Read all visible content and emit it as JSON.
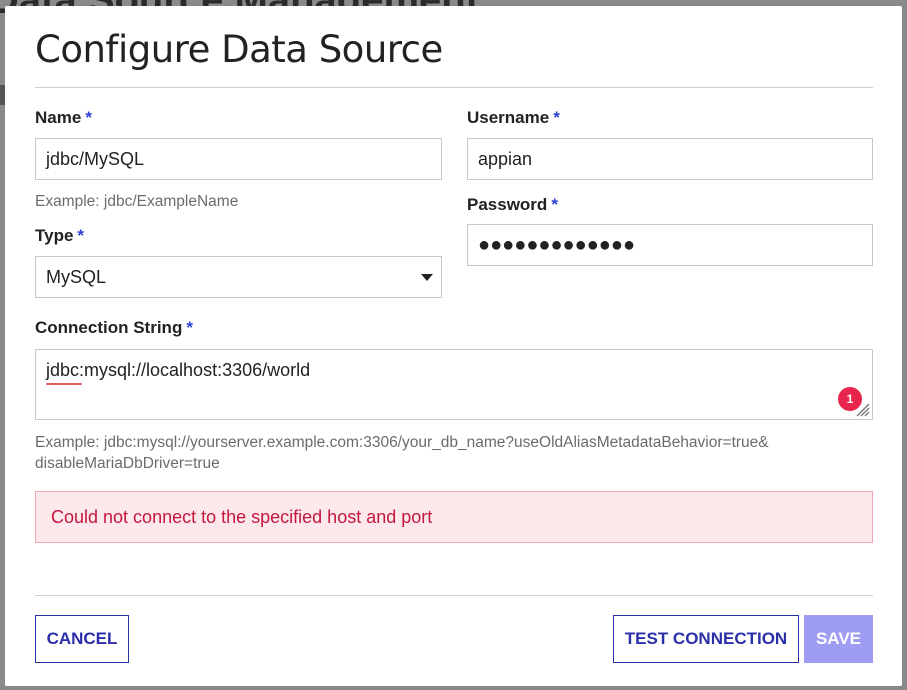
{
  "backdrop": {
    "title": "Data Source Management"
  },
  "modal": {
    "title": "Configure Data Source"
  },
  "form": {
    "required_mark": "*",
    "name": {
      "label": "Name",
      "value": "jdbc/MySQL",
      "hint": "Example: jdbc/ExampleName"
    },
    "type": {
      "label": "Type",
      "selected": "MySQL"
    },
    "username": {
      "label": "Username",
      "value": "appian"
    },
    "password": {
      "label": "Password",
      "masked_value": "●●●●●●●●●●●●●"
    },
    "connection_string": {
      "label": "Connection String",
      "value": "jdbc:mysql://localhost:3306/world",
      "hint_line1": "Example: jdbc:mysql://yourserver.example.com:3306/your_db_name?useOldAliasMetadataBehavior=true&",
      "hint_line2": "disableMariaDbDriver=true",
      "issue_count": "1"
    }
  },
  "error": {
    "message": "Could not connect to the specified host and port"
  },
  "buttons": {
    "cancel": "CANCEL",
    "test_connection": "TEST CONNECTION",
    "save": "SAVE"
  },
  "colors": {
    "accent": "#2b2fa8",
    "required": "#2b3fd6",
    "error_text": "#c4163e",
    "error_bg": "#fde8ec",
    "badge": "#e8254c",
    "save_disabled": "#9e9cf3"
  }
}
